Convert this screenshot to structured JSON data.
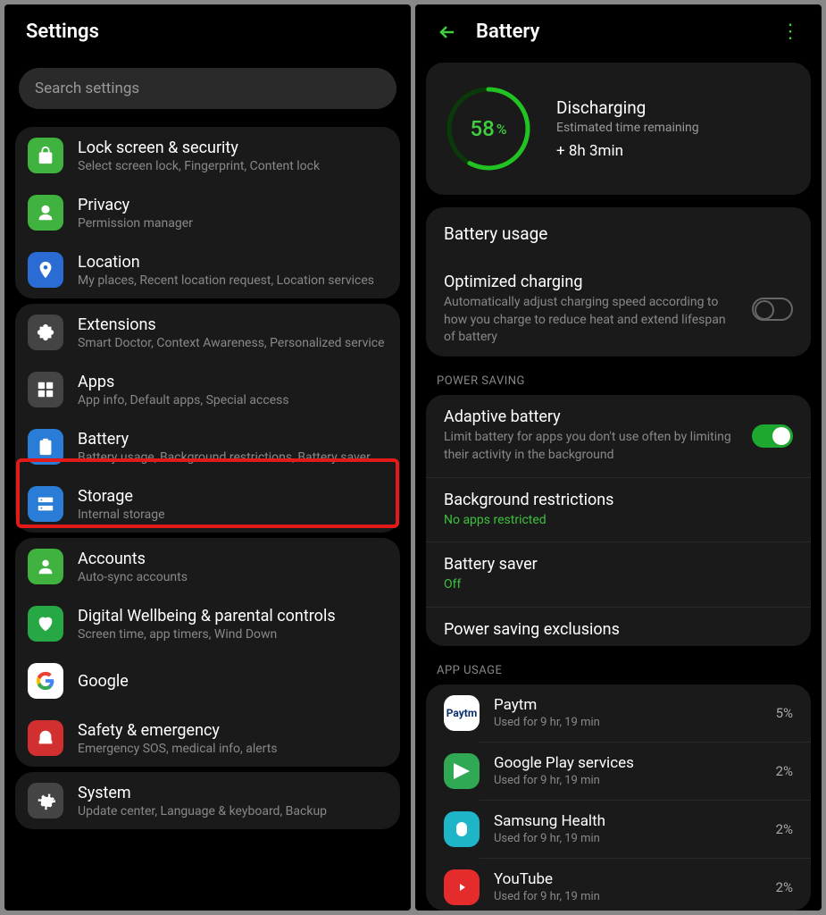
{
  "left": {
    "title": "Settings",
    "search_placeholder": "Search settings",
    "groups": [
      {
        "items": [
          {
            "icon": "lock",
            "color": "#3fb23f",
            "title": "Lock screen & security",
            "sub": "Select screen lock, Fingerprint, Content lock"
          },
          {
            "icon": "privacy",
            "color": "#3fb23f",
            "title": "Privacy",
            "sub": "Permission manager"
          },
          {
            "icon": "location",
            "color": "#2a6cd4",
            "title": "Location",
            "sub": "My places, Recent location request, Location services"
          }
        ]
      },
      {
        "items": [
          {
            "icon": "puzzle",
            "color": "#444",
            "title": "Extensions",
            "sub": "Smart Doctor, Context Awareness, Personalized service"
          },
          {
            "icon": "apps",
            "color": "#444",
            "title": "Apps",
            "sub": "App info, Default apps, Special access"
          },
          {
            "icon": "battery",
            "color": "#2a7dd6",
            "title": "Battery",
            "sub": "Battery usage, Background restrictions, Battery saver",
            "highlight": true
          },
          {
            "icon": "storage",
            "color": "#2a7dd6",
            "title": "Storage",
            "sub": "Internal storage"
          }
        ]
      },
      {
        "items": [
          {
            "icon": "accounts",
            "color": "#3fb23f",
            "title": "Accounts",
            "sub": "Auto-sync accounts"
          },
          {
            "icon": "wellbeing",
            "color": "#26a944",
            "title": "Digital Wellbeing & parental controls",
            "sub": "Screen time, app timers, Wind Down"
          },
          {
            "icon": "google",
            "color": "#fff",
            "title": "Google",
            "sub": ""
          },
          {
            "icon": "emergency",
            "color": "#d23030",
            "title": "Safety & emergency",
            "sub": "Emergency SOS, medical info, alerts"
          }
        ]
      },
      {
        "items": [
          {
            "icon": "system",
            "color": "#444",
            "title": "System",
            "sub": "Update center, Language & keyboard, Backup"
          }
        ]
      }
    ]
  },
  "right": {
    "title": "Battery",
    "percent": "58",
    "status": "Discharging",
    "remaining_label": "Estimated time remaining",
    "remaining_value": "+ 8h 3min",
    "usage_label": "Battery usage",
    "optimized": {
      "title": "Optimized charging",
      "sub": "Automatically adjust charging speed according to how you charge to reduce heat and extend lifespan of battery"
    },
    "power_saving_header": "POWER SAVING",
    "adaptive": {
      "title": "Adaptive battery",
      "sub": "Limit battery for apps you don't use often by limiting their activity in the background"
    },
    "restrictions": {
      "title": "Background restrictions",
      "sub": "No apps restricted"
    },
    "saver": {
      "title": "Battery saver",
      "sub": "Off"
    },
    "exclusions": "Power saving exclusions",
    "app_usage_header": "APP USAGE",
    "apps": [
      {
        "name": "Paytm",
        "sub": "Used for 9 hr, 19 min",
        "pct": "5%",
        "bg": "#fff"
      },
      {
        "name": "Google Play services",
        "sub": "Used for 9 hr, 19 min",
        "pct": "2%",
        "bg": "#31a854"
      },
      {
        "name": "Samsung Health",
        "sub": "Used for 9 hr, 19 min",
        "pct": "2%",
        "bg": "#1fb5c9"
      },
      {
        "name": "YouTube",
        "sub": "Used for 9 hr, 19 min",
        "pct": "2%",
        "bg": "#e52c2c"
      }
    ]
  }
}
